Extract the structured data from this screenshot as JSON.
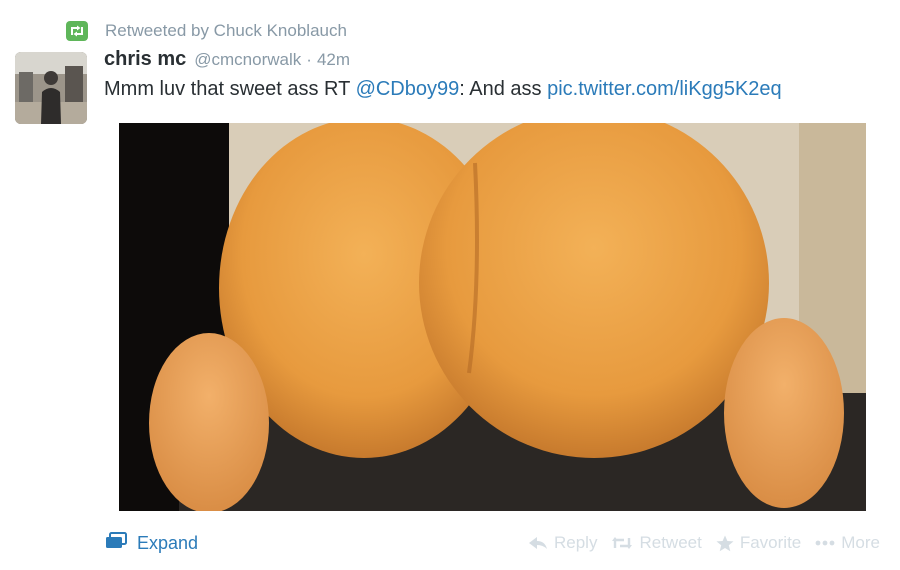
{
  "retweet_context": {
    "label": "Retweeted by Chuck Knoblauch",
    "icon": "retweet-icon",
    "badge_color": "#5fb65a"
  },
  "tweet": {
    "fullname": "chris mc",
    "username": "@cmcnorwalk",
    "separator": "·",
    "timestamp": "42m",
    "text_parts": {
      "lead": "Mmm luv that sweet ass RT ",
      "mention": "@CDboy99",
      "middle": ": And ass ",
      "link": "pic.twitter.com/liKgg5K2eq"
    },
    "link_color": "#2b7bb9"
  },
  "footer": {
    "expand_label": "Expand",
    "actions": {
      "reply": "Reply",
      "retweet": "Retweet",
      "favorite": "Favorite",
      "more": "More"
    },
    "muted_color": "#d5dde3"
  }
}
